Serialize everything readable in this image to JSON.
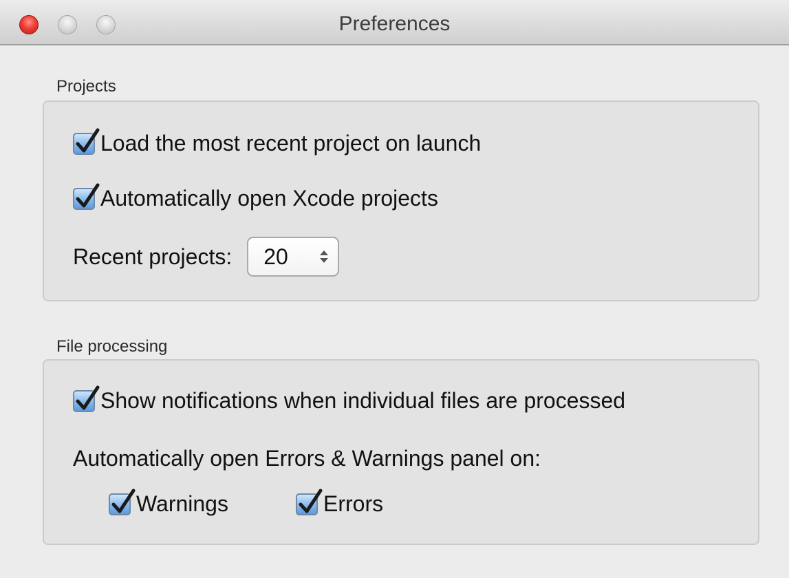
{
  "window": {
    "title": "Preferences"
  },
  "projects": {
    "section_label": "Projects",
    "load_recent": {
      "label": "Load the most recent project on launch",
      "checked": true
    },
    "open_xcode": {
      "label": "Automatically open Xcode projects",
      "checked": true
    },
    "recent_projects": {
      "label": "Recent projects:",
      "value": "20"
    }
  },
  "file_processing": {
    "section_label": "File processing",
    "show_notifications": {
      "label": "Show notifications when individual files are processed",
      "checked": true
    },
    "auto_open_label": "Automatically open Errors & Warnings panel on:",
    "warnings": {
      "label": "Warnings",
      "checked": true
    },
    "errors": {
      "label": "Errors",
      "checked": true
    }
  },
  "icons": {
    "checkmark": "checkmark-icon",
    "stepper": "stepper-arrows-icon"
  },
  "colors": {
    "close_button": "#ee3e36",
    "checkbox_fill": "#8dbcec",
    "window_background": "#ececec"
  }
}
